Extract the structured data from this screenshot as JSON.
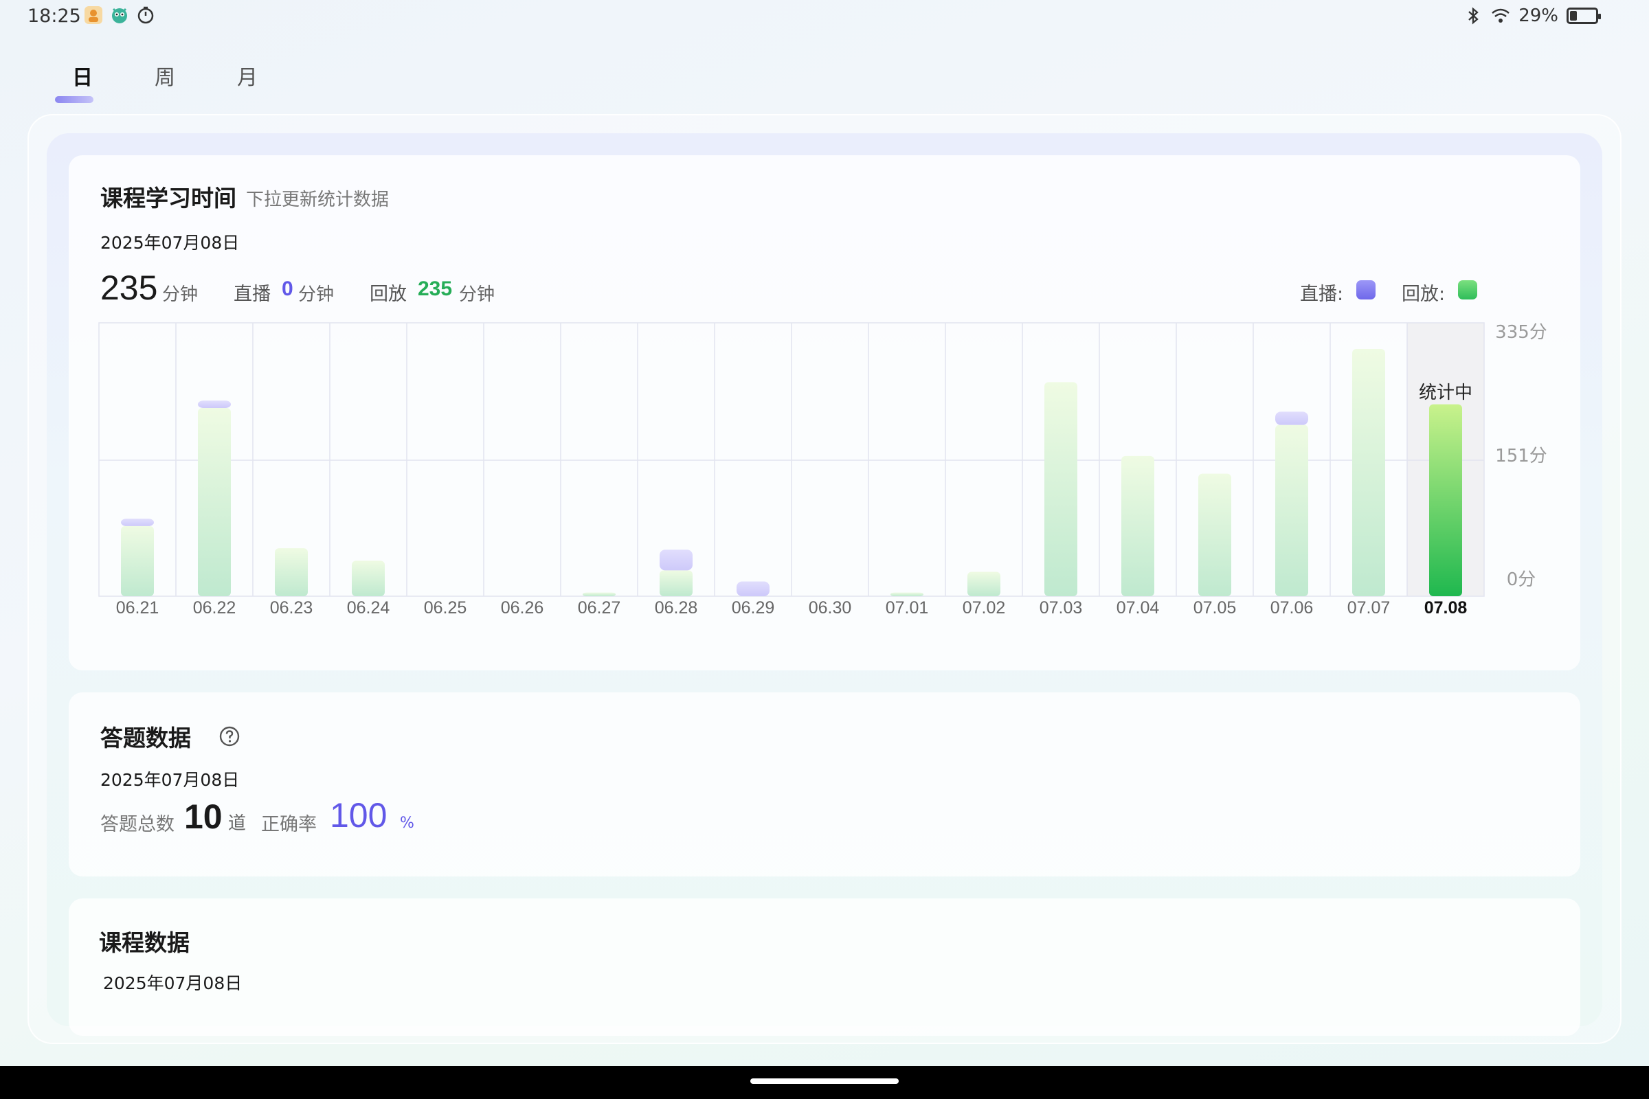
{
  "status": {
    "time": "18:25",
    "battery": "29%",
    "battery_level": 0.29,
    "icons_left": [
      "notification-app-icon",
      "monster-app-icon",
      "timer-icon"
    ],
    "icons_right": [
      "bluetooth-icon",
      "wifi-icon",
      "battery-icon"
    ]
  },
  "tabs": [
    {
      "label": "日",
      "active": true
    },
    {
      "label": "周",
      "active": false
    },
    {
      "label": "月",
      "active": false
    }
  ],
  "study": {
    "title": "课程学习时间",
    "hint": "下拉更新统计数据",
    "date": "2025年07月08日",
    "total_value": "235",
    "total_unit": "分钟",
    "live_label": "直播",
    "live_value": "0",
    "live_unit": "分钟",
    "replay_label": "回放",
    "replay_value": "235",
    "replay_unit": "分钟",
    "legend_live": "直播:",
    "legend_replay": "回放:",
    "colors": {
      "live": "#7d76ef",
      "replay": "#3cc86a"
    }
  },
  "chart_data": {
    "type": "bar",
    "stacked": true,
    "categories": [
      "06.21",
      "06.22",
      "06.23",
      "06.24",
      "06.25",
      "06.26",
      "06.27",
      "06.28",
      "06.29",
      "06.30",
      "07.01",
      "07.02",
      "07.03",
      "07.04",
      "07.05",
      "07.06",
      "07.07",
      "07.08"
    ],
    "series": [
      {
        "name": "直播",
        "values": [
          10,
          10,
          0,
          0,
          0,
          0,
          0,
          28,
          20,
          0,
          0,
          0,
          0,
          0,
          0,
          18,
          0,
          0
        ]
      },
      {
        "name": "回放",
        "values": [
          95,
          255,
          65,
          48,
          0,
          0,
          5,
          35,
          0,
          0,
          5,
          33,
          290,
          190,
          166,
          232,
          335,
          260
        ]
      }
    ],
    "y_ticks": [
      "335分",
      "151分",
      "0分"
    ],
    "ylim": [
      0,
      335
    ],
    "highlight_index": 17,
    "highlight_label": "统计中",
    "grid": true
  },
  "quiz": {
    "title": "答题数据",
    "date": "2025年07月08日",
    "total_label": "答题总数",
    "total_value": "10",
    "total_unit": "道",
    "accuracy_label": "正确率",
    "accuracy_value": "100",
    "accuracy_unit": "%"
  },
  "course": {
    "title": "课程数据",
    "date": "2025年07月08日"
  }
}
